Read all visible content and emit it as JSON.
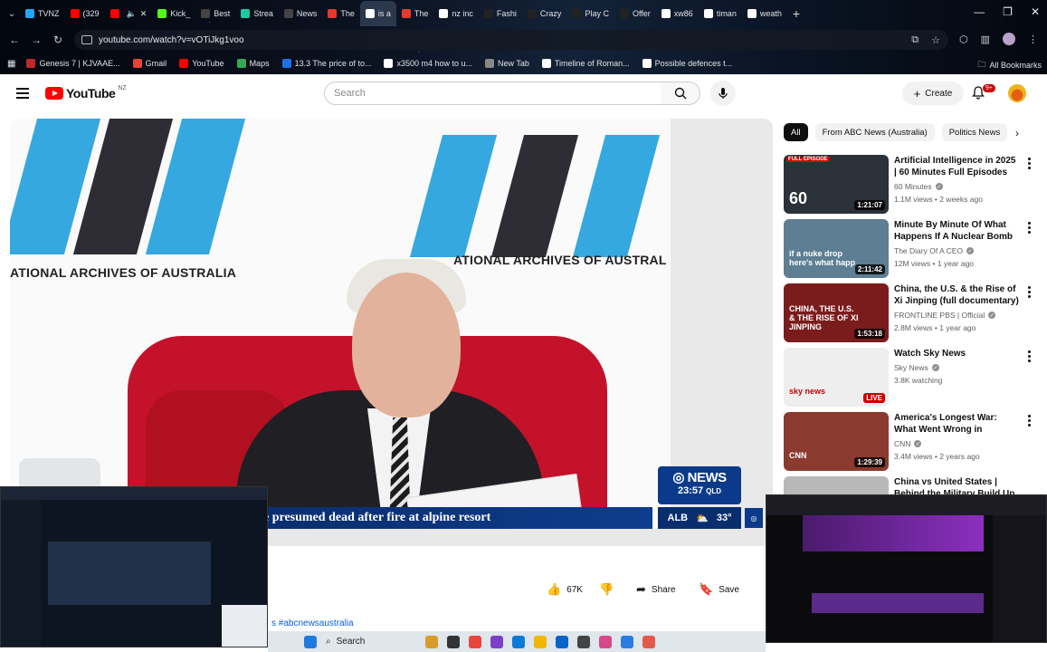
{
  "browser": {
    "tabs": [
      {
        "label": "TVNZ",
        "color": "#1ea7fd"
      },
      {
        "label": "(329",
        "color": "#ff0000"
      },
      {
        "label": "",
        "color": "#ff0000"
      },
      {
        "label": "Kick_",
        "color": "#53fc18"
      },
      {
        "label": "Best",
        "color": "#444444"
      },
      {
        "label": "Strea",
        "color": "#1ec8a5"
      },
      {
        "label": "News",
        "color": "#444444"
      },
      {
        "label": "The",
        "color": "#e23b2e"
      },
      {
        "label": "is a",
        "color": "#ffffff"
      },
      {
        "label": "The",
        "color": "#e23b2e"
      },
      {
        "label": "nz inc",
        "color": "#ffffff"
      },
      {
        "label": "Fashi",
        "color": "#222222"
      },
      {
        "label": "Crazy",
        "color": "#222222"
      },
      {
        "label": "Play C",
        "color": "#222222"
      },
      {
        "label": "Offer",
        "color": "#222222"
      },
      {
        "label": "xw86",
        "color": "#ffffff"
      },
      {
        "label": "timan",
        "color": "#ffffff"
      },
      {
        "label": "weath",
        "color": "#ffffff"
      }
    ],
    "url": "youtube.com/watch?v=vOTiJkg1voo",
    "bookmarks": [
      {
        "label": "Genesis 7 | KJVAAE...",
        "color": "#c2272d"
      },
      {
        "label": "Gmail",
        "color": "#ea4335"
      },
      {
        "label": "YouTube",
        "color": "#ff0000"
      },
      {
        "label": "Maps",
        "color": "#34a853"
      },
      {
        "label": "13.3 The price of to...",
        "color": "#1a73e8"
      },
      {
        "label": "x3500 m4 how to u...",
        "color": "#ffffff"
      },
      {
        "label": "New Tab",
        "color": "#888888"
      },
      {
        "label": "Timeline of Roman...",
        "color": "#ffffff"
      },
      {
        "label": "Possible defences t...",
        "color": "#ffffff"
      }
    ],
    "all_bookmarks": "All Bookmarks"
  },
  "youtube": {
    "logo_text": "YouTube",
    "region": "NZ",
    "search_placeholder": "Search",
    "create_label": "Create",
    "notifications_badge": "9+"
  },
  "video": {
    "banner_left": "NAA",
    "banner_right": "NAA",
    "archives_left": "ATIONAL ARCHIVES OF AUSTRALIA",
    "archives_right": "ATIONAL ARCHIVES OF AUSTRAL",
    "lower_third": "e presumed dead after fire at alpine resort",
    "abc_news": "NEWS",
    "abc_time": "23:57",
    "abc_zone": "QLD",
    "weather_city": "ALB",
    "weather_temp": "33°",
    "hashtag": "s #abcnewsaustralia"
  },
  "actions": {
    "likes": "67K",
    "share": "Share",
    "save": "Save"
  },
  "filters": {
    "chips": [
      "All",
      "From ABC News (Australia)",
      "Politics News"
    ]
  },
  "recommendations": [
    {
      "title": "Artificial Intelligence in 2025 | 60 Minutes Full Episodes",
      "channel": "60 Minutes",
      "meta": "1.1M views • 2 weeks ago",
      "duration": "1:21:07",
      "thumb_text": "60",
      "thumb_tag": "FULL EPISODE",
      "thumb_bg": "#2a3138"
    },
    {
      "title": "Minute By Minute Of What Happens If A Nuclear Bomb ...",
      "channel": "The Diary Of A CEO",
      "meta": "12M views • 1 year ago",
      "duration": "2:11:42",
      "thumb_text": "if a nuke drop here's what happ",
      "thumb_tag": "",
      "thumb_bg": "#5d7e93"
    },
    {
      "title": "China, the U.S. & the Rise of Xi Jinping (full documentary) | ...",
      "channel": "FRONTLINE PBS | Official",
      "meta": "2.8M views • 1 year ago",
      "duration": "1:53:18",
      "thumb_text": "CHINA, THE U.S. & THE RISE OF XI JINPING",
      "thumb_tag": "",
      "thumb_bg": "#7a1c1c"
    },
    {
      "title": "Watch Sky News",
      "channel": "Sky News",
      "meta": "3.8K watching",
      "duration": "LIVE",
      "thumb_text": "sky news",
      "thumb_tag": "",
      "thumb_bg": "#eeeeee"
    },
    {
      "title": "America's Longest War: What Went Wrong in Afghanistan ...",
      "channel": "CNN",
      "meta": "3.4M views • 2 years ago",
      "duration": "1:29:39",
      "thumb_text": "CNN",
      "thumb_tag": "",
      "thumb_bg": "#8a3a2e"
    },
    {
      "title": "China vs United States | Behind the Military Build Up",
      "channel": "",
      "meta": "",
      "duration": "",
      "thumb_text": "",
      "thumb_tag": "",
      "thumb_bg": "#b8b8b8"
    }
  ],
  "taskbar": {
    "search_label": "Search"
  }
}
